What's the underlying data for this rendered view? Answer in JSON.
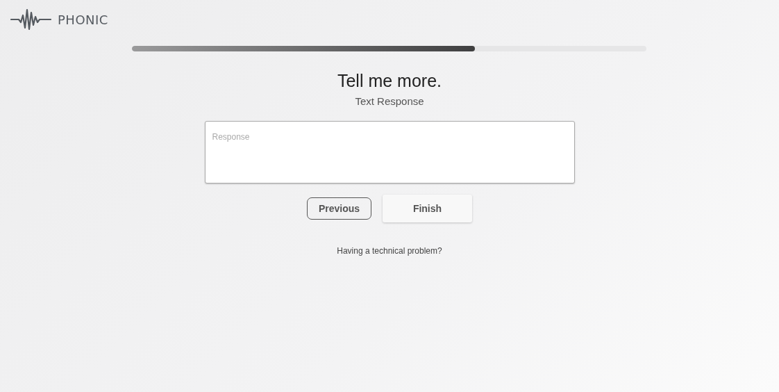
{
  "brand": {
    "name": "PHONIC"
  },
  "progress": {
    "level": 0.667
  },
  "question": {
    "title": "Tell me more.",
    "type": "Text Response"
  },
  "response": {
    "placeholder": "Response"
  },
  "buttons": [
    {
      "label": "Previous",
      "kind": "outlined"
    },
    {
      "label": "Finish",
      "kind": "raised"
    }
  ],
  "help_link": "Having a technical problem?"
}
